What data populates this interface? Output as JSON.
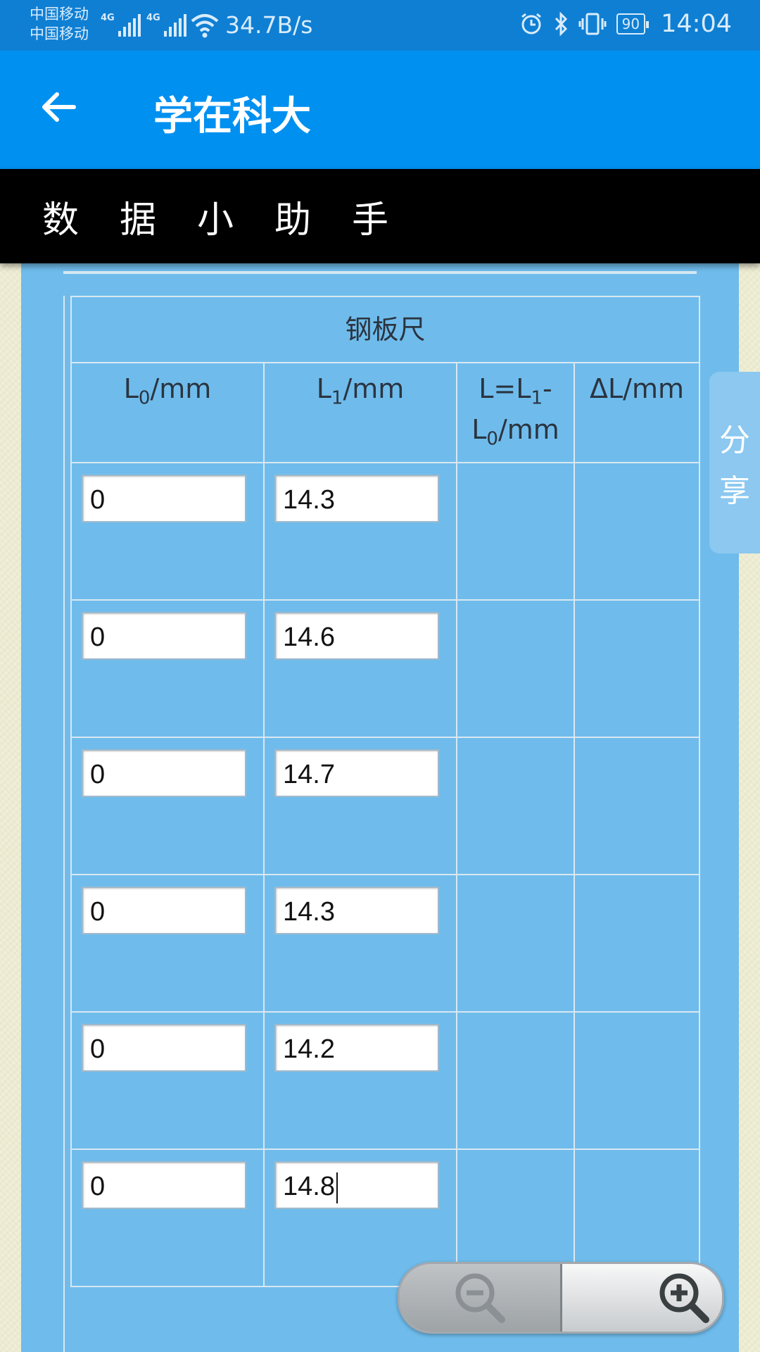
{
  "status_bar": {
    "carrier1": "中国移动",
    "carrier2": "中国移动",
    "net1": "4G",
    "net2": "4G",
    "speed": "34.7B/s",
    "battery": "90",
    "time": "14:04",
    "icons": [
      "alarm-icon",
      "bluetooth-icon",
      "vibrate-icon"
    ]
  },
  "appbar": {
    "title": "学在科大",
    "back_icon": "arrow-left-icon"
  },
  "header": {
    "title": "数据小助手"
  },
  "table": {
    "caption": "钢板尺",
    "columns": [
      "L0/mm",
      "L1/mm",
      "L=L1-L0/mm",
      "ΔL/mm"
    ],
    "rows": [
      {
        "l0": "0",
        "l1": "14.3"
      },
      {
        "l0": "0",
        "l1": "14.6"
      },
      {
        "l0": "0",
        "l1": "14.7"
      },
      {
        "l0": "0",
        "l1": "14.3"
      },
      {
        "l0": "0",
        "l1": "14.2"
      },
      {
        "l0": "0",
        "l1": "14.8"
      }
    ]
  },
  "share": {
    "line1": "分",
    "line2": "享"
  },
  "zoom": {
    "out_icon": "zoom-out-icon",
    "in_icon": "zoom-in-icon"
  },
  "colors": {
    "appbar": "#0090f0",
    "statusbar": "#0f7fd3",
    "panel": "#6fbcec",
    "header": "#000000"
  }
}
